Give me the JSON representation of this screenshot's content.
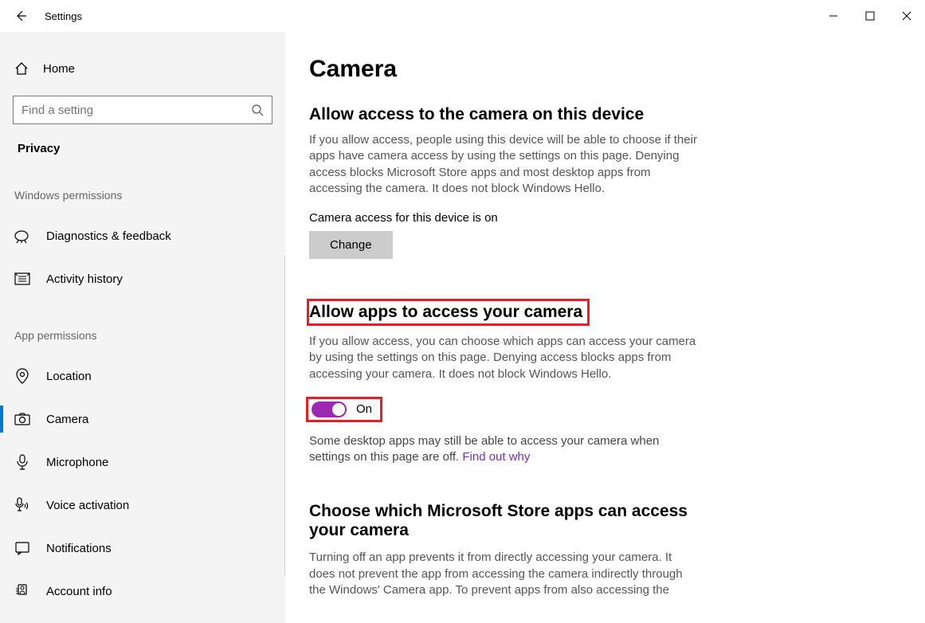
{
  "titlebar": {
    "app_title": "Settings"
  },
  "sidebar": {
    "home": "Home",
    "search_placeholder": "Find a setting",
    "crumb": "Privacy",
    "section1_label": "Windows permissions",
    "section2_label": "App permissions",
    "items1": [
      {
        "label": "Diagnostics & feedback"
      },
      {
        "label": "Activity history"
      }
    ],
    "items2": [
      {
        "label": "Location"
      },
      {
        "label": "Camera"
      },
      {
        "label": "Microphone"
      },
      {
        "label": "Voice activation"
      },
      {
        "label": "Notifications"
      },
      {
        "label": "Account info"
      }
    ]
  },
  "content": {
    "page_title": "Camera",
    "sec1": {
      "heading": "Allow access to the camera on this device",
      "desc": "If you allow access, people using this device will be able to choose if their apps have camera access by using the settings on this page. Denying access blocks Microsoft Store apps and most desktop apps from accessing the camera. It does not block Windows Hello.",
      "status": "Camera access for this device is on",
      "change_btn": "Change"
    },
    "sec2": {
      "heading": "Allow apps to access your camera",
      "desc": "If you allow access, you can choose which apps can access your camera by using the settings on this page. Denying access blocks apps from accessing your camera. It does not block Windows Hello.",
      "toggle_label": "On",
      "footnote": "Some desktop apps may still be able to access your camera when settings on this page are off. ",
      "link": "Find out why"
    },
    "sec3": {
      "heading": "Choose which Microsoft Store apps can access your camera",
      "desc": "Turning off an app prevents it from directly accessing your camera. It does not prevent the app from accessing the camera indirectly through the Windows' Camera app. To prevent apps from also accessing the"
    }
  }
}
